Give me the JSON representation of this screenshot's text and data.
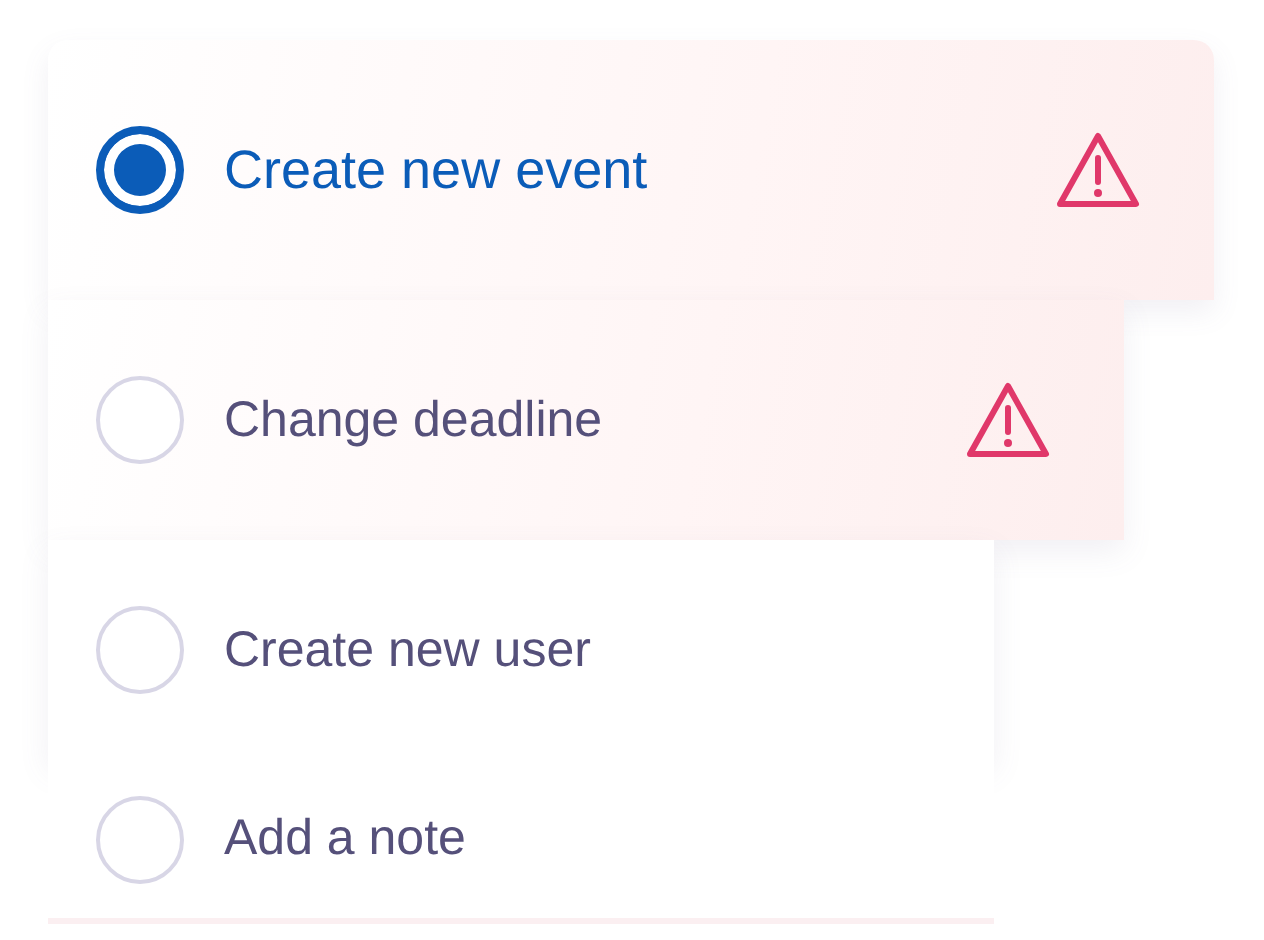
{
  "options": [
    {
      "label": "Create new event",
      "selected": true,
      "warning": true
    },
    {
      "label": "Change deadline",
      "selected": false,
      "warning": true
    },
    {
      "label": "Create new user",
      "selected": false,
      "warning": false
    },
    {
      "label": "Add a note",
      "selected": false,
      "warning": false
    }
  ]
}
